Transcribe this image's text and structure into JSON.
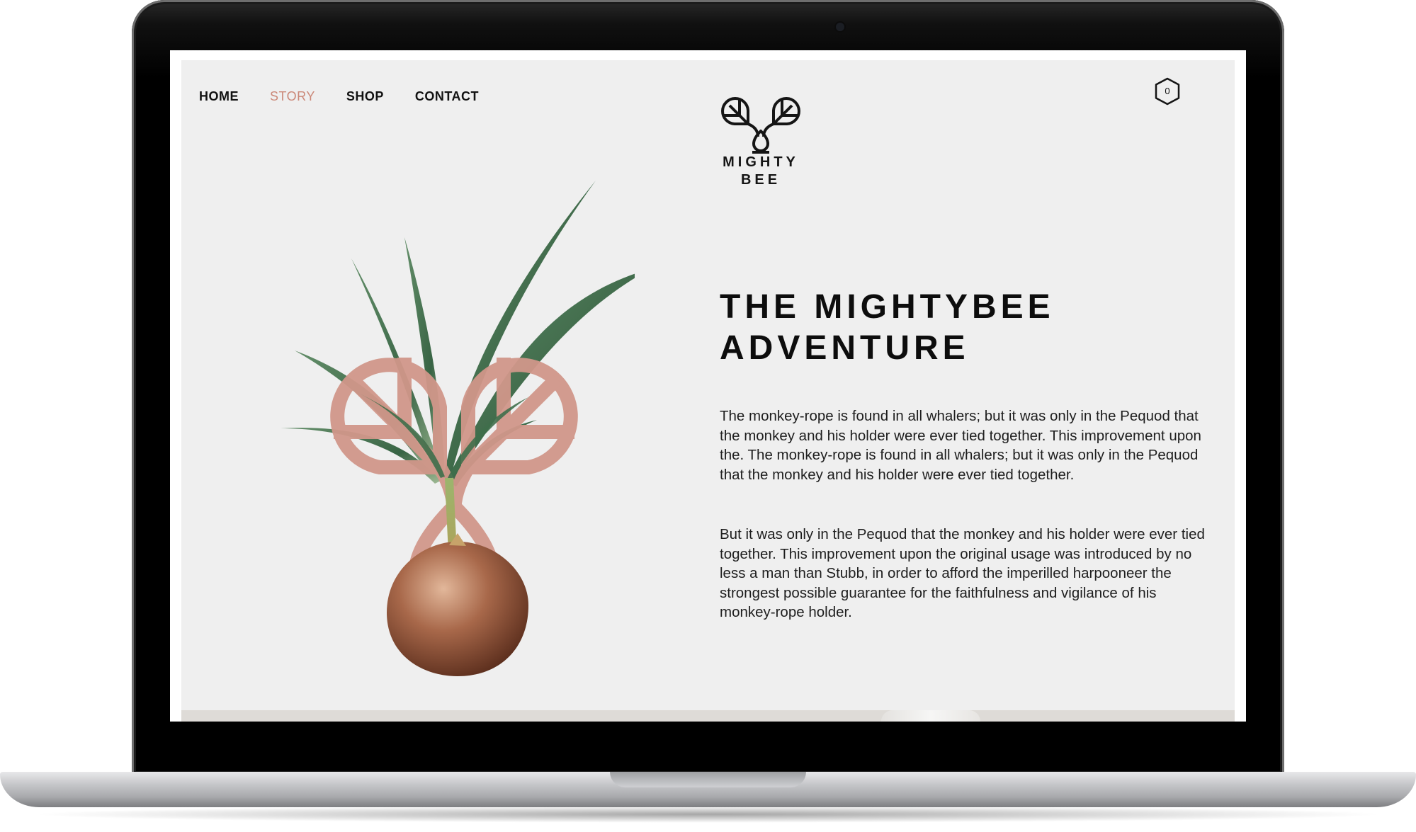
{
  "site": {
    "nav": {
      "items": [
        {
          "label": "HOME",
          "active": false
        },
        {
          "label": "STORY",
          "active": true
        },
        {
          "label": "SHOP",
          "active": false
        },
        {
          "label": "CONTACT",
          "active": false
        }
      ]
    },
    "logo": {
      "line1": "MIGHTY",
      "line2": "BEE",
      "icon": "two-leaves-drop-icon"
    },
    "cart": {
      "count": "0",
      "icon": "hexagon-cart-icon"
    },
    "hero": {
      "title_line1": "THE MIGHTYBEE",
      "title_line2": "ADVENTURE",
      "paragraphs": [
        "The monkey-rope is found in all whalers; but it was only in the Pequod that the monkey and his holder were ever tied together. This improvement upon the. The monkey-rope is found in all whalers; but it was only in the Pequod that the monkey and his holder were ever tied together.",
        "But it was only in the Pequod that the monkey and his holder were ever tied together. This improvement upon the original usage was introduced by no less a man than Stubb, in order to afford the imperilled harpooneer the strongest possible guarantee for the faithfulness and vigilance of his monkey-rope holder."
      ]
    },
    "illustration": {
      "subject": "coconut-sprout-with-leaf-logo-overlay",
      "logo_color": "#d1978a"
    },
    "colors": {
      "accent": "#cb8878",
      "background": "#efefef",
      "text": "#121212"
    }
  }
}
